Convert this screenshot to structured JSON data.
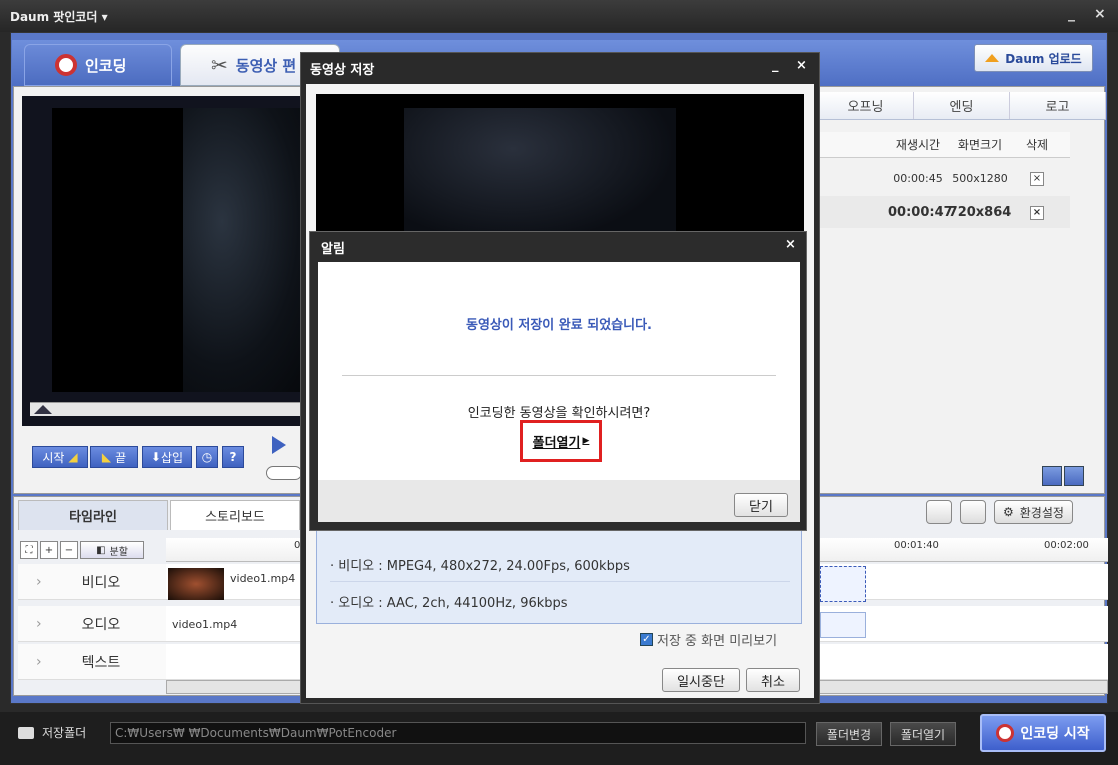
{
  "window": {
    "title": "Daum 팟인코더 ▾",
    "minimize": "_",
    "close": "×"
  },
  "tabs": {
    "encode": "인코딩",
    "edit": "동영상 편"
  },
  "upload_button": "Daum 업로드",
  "right_tabs": [
    "오프닝",
    "엔딩",
    "로고"
  ],
  "list": {
    "headers": [
      "재생시간",
      "화면크기",
      "삭제"
    ],
    "rows": [
      {
        "time": "00:00:45",
        "size": "500x1280",
        "del": "×"
      },
      {
        "time": "00:00:47",
        "size": "720x864",
        "del": "×"
      }
    ]
  },
  "player": {
    "start": "시작",
    "end": "끝",
    "insert": "삽입",
    "help": "?"
  },
  "timeline": {
    "tabs": {
      "timeline": "타임라인",
      "storyboard": "스토리보드"
    },
    "split": "분할",
    "ruler": {
      "start": "0",
      "t1": "00:01:40",
      "t2": "00:02:00"
    },
    "tracks": {
      "video": "비디오",
      "audio": "오디오",
      "text": "텍스트"
    },
    "video_clip": "video1.mp4",
    "audio_clip": "video1.mp4",
    "settings": "환경설정"
  },
  "footer": {
    "folder_label": "저장폴더",
    "path": "C:₩Users₩        ₩Documents₩Daum₩PotEncoder",
    "change": "폴더변경",
    "open": "폴더열기",
    "start": "인코딩 시작"
  },
  "save_dialog": {
    "title": "동영상 저장",
    "minimize": "_",
    "close": "×",
    "info": [
      "· 비디오 : MPEG4, 480x272, 24.00Fps, 600kbps",
      "· 오디오 : AAC, 2ch, 44100Hz, 96kbps"
    ],
    "preview_check": "저장 중 화면 미리보기",
    "pause": "일시중단",
    "cancel": "취소"
  },
  "alert": {
    "title": "알림",
    "close": "×",
    "message": "동영상이 저장이 완료 되었습니다.",
    "question": "인코딩한 동영상을 확인하시려면?",
    "open_folder": "폴더열기",
    "close_button": "닫기"
  }
}
